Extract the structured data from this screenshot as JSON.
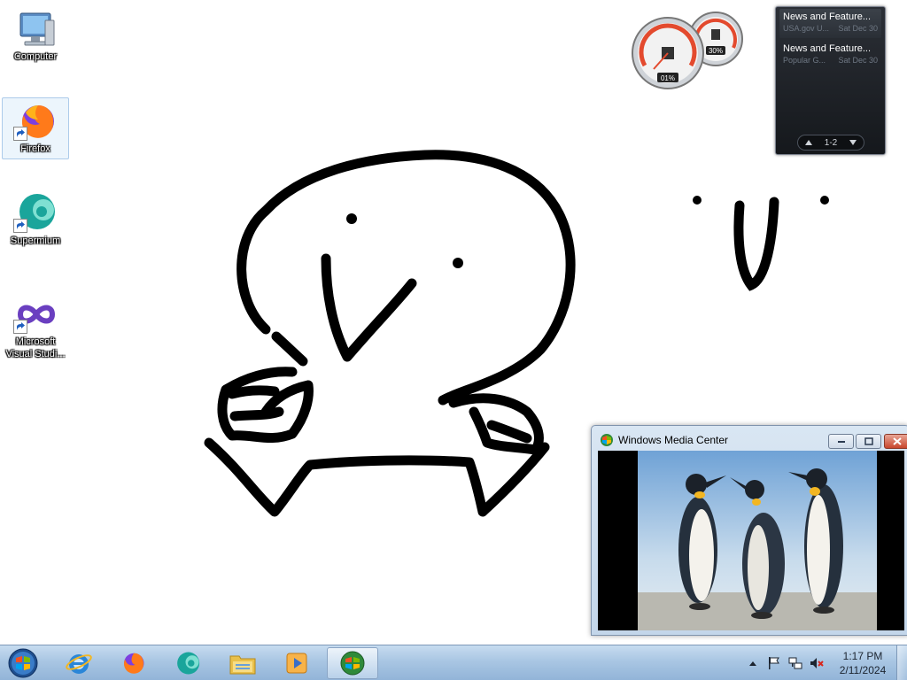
{
  "desktop": {
    "icons": [
      {
        "label": "Computer",
        "icon": "computer-icon"
      },
      {
        "label": "Firefox",
        "icon": "firefox-icon",
        "selected": true
      },
      {
        "label": "Supermium",
        "icon": "supermium-icon"
      },
      {
        "label": "Microsoft\nVisual Studi...",
        "icon": "visual-studio-icon"
      }
    ]
  },
  "gadgets": {
    "cpu_meter": {
      "cpu_percent": "01%",
      "memory_percent": "30%"
    },
    "news": {
      "items": [
        {
          "title": "News and Feature...",
          "source": "USA.gov U...",
          "date": "Sat Dec 30"
        },
        {
          "title": "News and Feature...",
          "source": "Popular G...",
          "date": "Sat Dec 30"
        }
      ],
      "pager": "1-2"
    }
  },
  "media_center_window": {
    "title": "Windows Media Center"
  },
  "taskbar": {
    "pinned": [
      "start-orb-icon",
      "internet-explorer-icon",
      "firefox-icon",
      "supermium-icon",
      "file-explorer-icon",
      "media-player-icon",
      "media-center-icon"
    ],
    "active": "media-center-icon",
    "clock": {
      "time": "1:17 PM",
      "date": "2/11/2024"
    }
  },
  "colors": {
    "taskbar_top": "#c7dcf0",
    "taskbar_bottom": "#92b4d8",
    "news_gadget_bg": "#15181c",
    "window_frame": "#c3d6ea",
    "close_button": "#c8462c"
  }
}
